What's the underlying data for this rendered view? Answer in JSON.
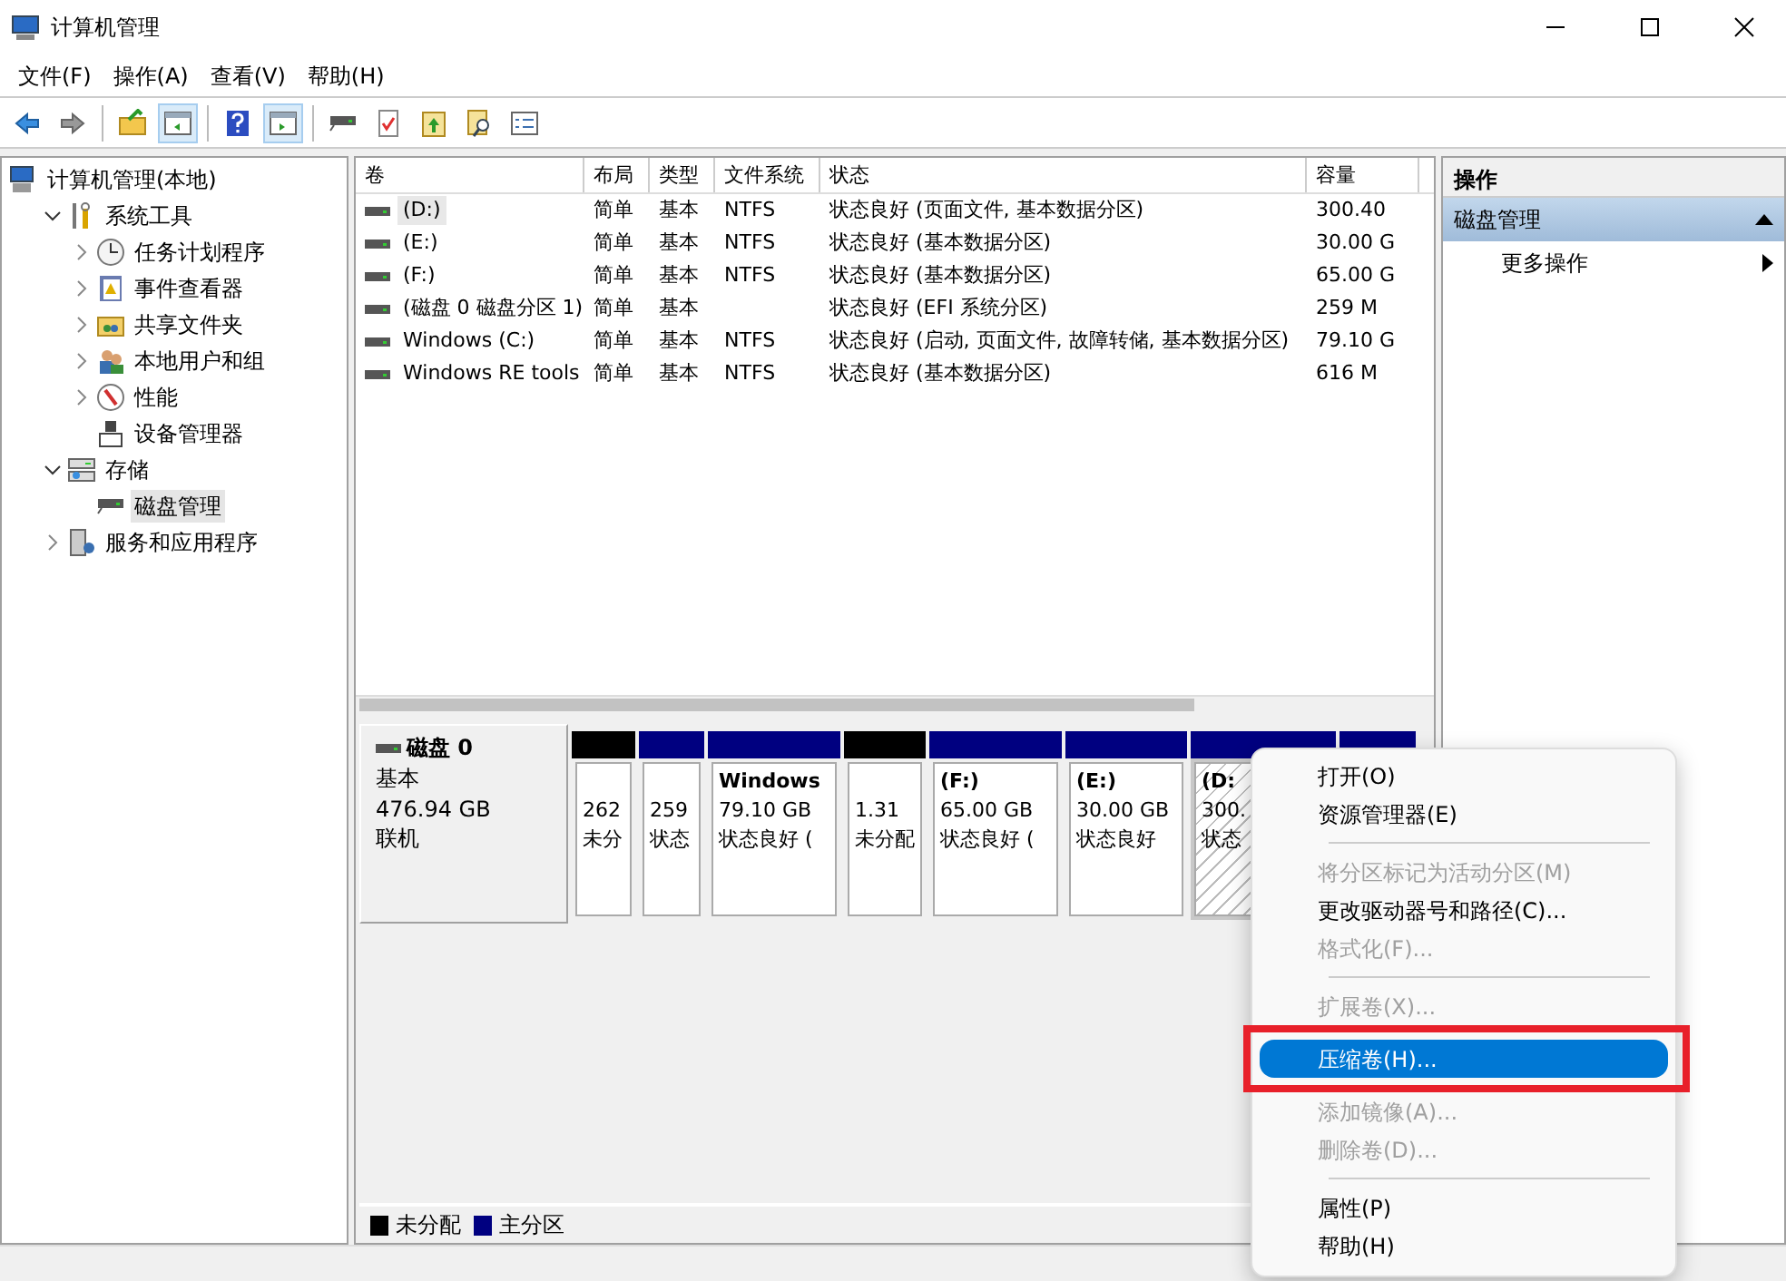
{
  "window": {
    "title": "计算机管理"
  },
  "menu_bar": [
    "文件(F)",
    "操作(A)",
    "查看(V)",
    "帮助(H)"
  ],
  "toolbar": [
    {
      "kind": "back",
      "pressed": false
    },
    {
      "kind": "forward",
      "pressed": false
    },
    {
      "kind": "separator"
    },
    {
      "kind": "up-folder",
      "pressed": false
    },
    {
      "kind": "console-tree",
      "pressed": true
    },
    {
      "kind": "separator"
    },
    {
      "kind": "help",
      "pressed": false
    },
    {
      "kind": "action-pane",
      "pressed": true
    },
    {
      "kind": "separator"
    },
    {
      "kind": "drive",
      "pressed": false
    },
    {
      "kind": "check",
      "pressed": false
    },
    {
      "kind": "export",
      "pressed": false
    },
    {
      "kind": "search",
      "pressed": false
    },
    {
      "kind": "list",
      "pressed": false
    }
  ],
  "tree": [
    {
      "label": "计算机管理(本地)",
      "kind": "computer",
      "selected": false,
      "children": [
        {
          "label": "系统工具",
          "kind": "tools",
          "expanded": true,
          "selected": false,
          "children": [
            {
              "label": "任务计划程序",
              "kind": "clock",
              "expanded": false,
              "selected": false
            },
            {
              "label": "事件查看器",
              "kind": "event",
              "expanded": false,
              "selected": false
            },
            {
              "label": "共享文件夹",
              "kind": "share",
              "expanded": false,
              "selected": false
            },
            {
              "label": "本地用户和组",
              "kind": "users",
              "expanded": false,
              "selected": false
            },
            {
              "label": "性能",
              "kind": "perf",
              "expanded": false,
              "selected": false
            },
            {
              "label": "设备管理器",
              "kind": "device",
              "selected": false
            }
          ]
        },
        {
          "label": "存储",
          "kind": "storage",
          "expanded": true,
          "selected": false,
          "children": [
            {
              "label": "磁盘管理",
              "kind": "disk",
              "selected": true
            }
          ]
        },
        {
          "label": "服务和应用程序",
          "kind": "services",
          "expanded": false,
          "selected": false
        }
      ]
    }
  ],
  "table": {
    "columns": [
      "卷",
      "布局",
      "类型",
      "文件系统",
      "状态",
      "容量"
    ],
    "rows": [
      {
        "cells": [
          "(D:)",
          "简单",
          "基本",
          "NTFS",
          "状态良好 (页面文件, 基本数据分区)",
          "300.40"
        ],
        "selected": true
      },
      {
        "cells": [
          "(E:)",
          "简单",
          "基本",
          "NTFS",
          "状态良好 (基本数据分区)",
          "30.00 G"
        ],
        "selected": false
      },
      {
        "cells": [
          "(F:)",
          "简单",
          "基本",
          "NTFS",
          "状态良好 (基本数据分区)",
          "65.00 G"
        ],
        "selected": false
      },
      {
        "cells": [
          "(磁盘 0 磁盘分区 1)",
          "简单",
          "基本",
          "",
          "状态良好 (EFI 系统分区)",
          "259 M"
        ],
        "selected": false
      },
      {
        "cells": [
          "Windows (C:)",
          "简单",
          "基本",
          "NTFS",
          "状态良好 (启动, 页面文件, 故障转储, 基本数据分区)",
          "79.10 G"
        ],
        "selected": false
      },
      {
        "cells": [
          "Windows RE tools",
          "简单",
          "基本",
          "NTFS",
          "状态良好 (基本数据分区)",
          "616 M"
        ],
        "selected": false
      }
    ]
  },
  "disk": {
    "name": "磁盘 0",
    "type": "基本",
    "size": "476.94 GB",
    "status": "联机",
    "partitions": [
      {
        "color": "#000000",
        "size": "262",
        "status": "未分",
        "selected": false
      },
      {
        "color": "#000080",
        "size": "259",
        "status": "状态",
        "selected": false
      },
      {
        "color": "#000080",
        "title": "Windows",
        "size": "79.10 GB",
        "status": "状态良好 (",
        "selected": false
      },
      {
        "color": "#000000",
        "size": "1.31",
        "status": "未分配",
        "selected": false
      },
      {
        "color": "#000080",
        "title": "(F:)",
        "size": "65.00 GB",
        "status": "状态良好 (",
        "selected": false
      },
      {
        "color": "#000080",
        "title": "(E:)",
        "size": "30.00 GB",
        "status": "状态良好",
        "selected": false
      },
      {
        "color": "#000080",
        "title": "(D:",
        "size": "300.",
        "status": "状态",
        "selected": true
      },
      {
        "color": "#000080"
      }
    ]
  },
  "legend": [
    {
      "label": "未分配",
      "color": "#000000"
    },
    {
      "label": "主分区",
      "color": "#000080"
    }
  ],
  "actions": {
    "header": "操作",
    "section": {
      "label": "磁盘管理",
      "expanded": true
    },
    "items": [
      "更多操作"
    ]
  },
  "context_menu": [
    {
      "kind": "item",
      "label": "打开(O)",
      "disabled": false,
      "selected": false
    },
    {
      "kind": "item",
      "label": "资源管理器(E)",
      "disabled": false,
      "selected": false
    },
    {
      "kind": "separator"
    },
    {
      "kind": "item",
      "label": "将分区标记为活动分区(M)",
      "disabled": true,
      "selected": false
    },
    {
      "kind": "item",
      "label": "更改驱动器号和路径(C)...",
      "disabled": false,
      "selected": false
    },
    {
      "kind": "item",
      "label": "格式化(F)...",
      "disabled": true,
      "selected": false
    },
    {
      "kind": "separator"
    },
    {
      "kind": "item",
      "label": "扩展卷(X)...",
      "disabled": true,
      "selected": false
    },
    {
      "kind": "item",
      "label": "压缩卷(H)...",
      "disabled": false,
      "selected": true
    },
    {
      "kind": "item",
      "label": "添加镜像(A)...",
      "disabled": true,
      "selected": false
    },
    {
      "kind": "item",
      "label": "删除卷(D)...",
      "disabled": true,
      "selected": false
    },
    {
      "kind": "separator"
    },
    {
      "kind": "item",
      "label": "属性(P)",
      "disabled": false,
      "selected": false
    },
    {
      "kind": "item",
      "label": "帮助(H)",
      "disabled": false,
      "selected": false
    }
  ]
}
